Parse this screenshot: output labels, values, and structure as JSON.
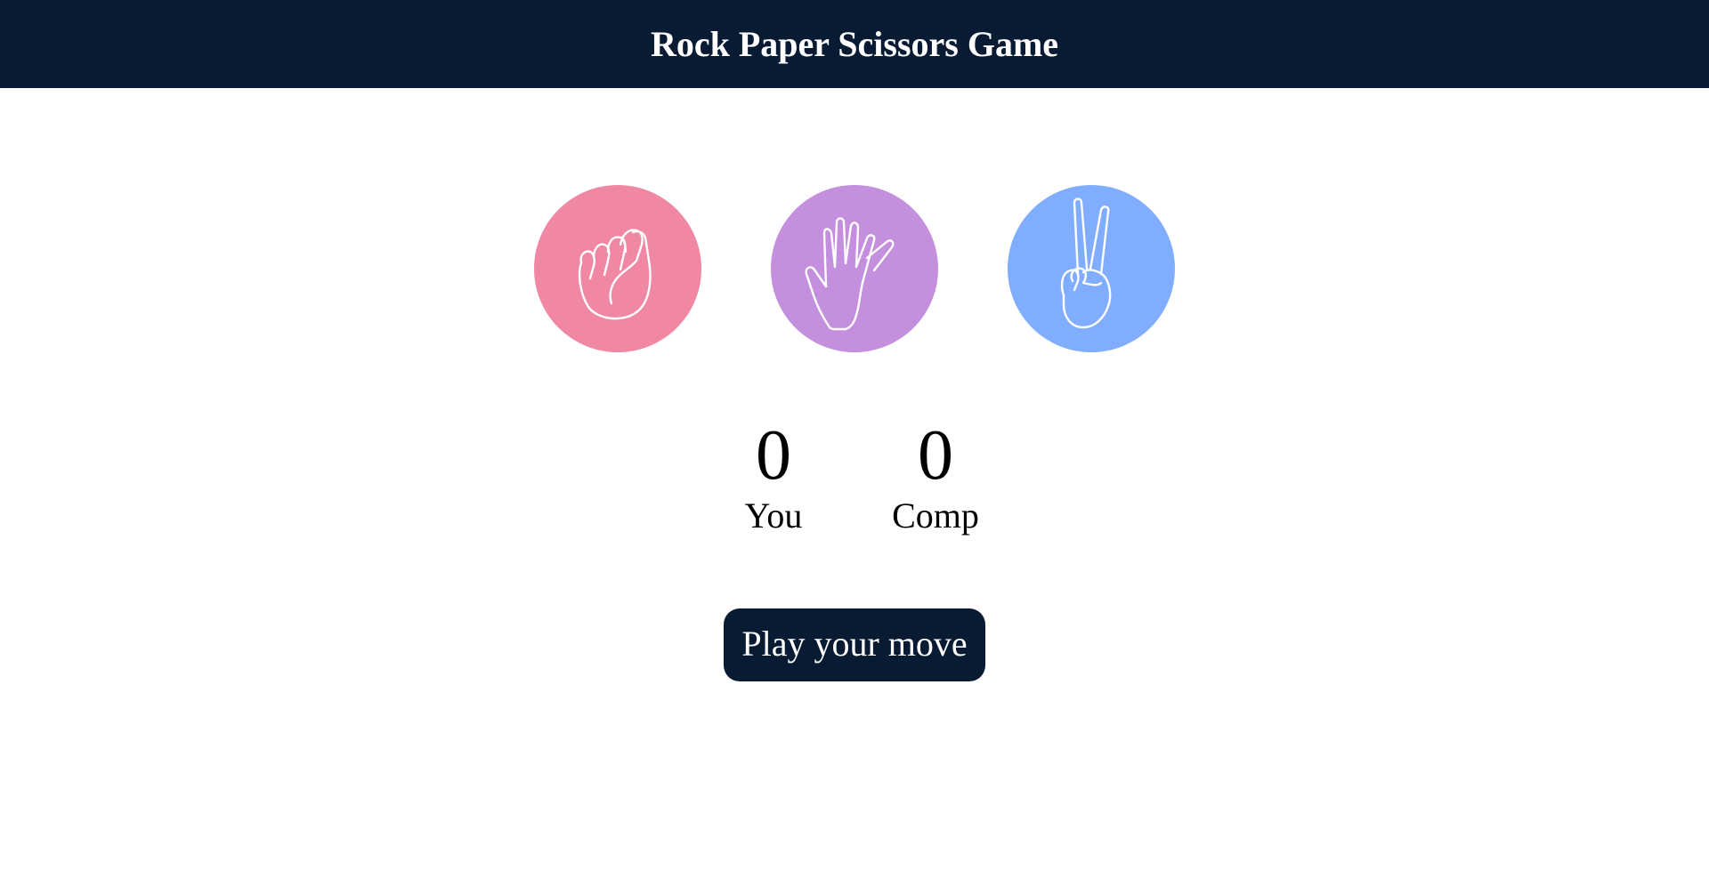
{
  "header": {
    "title": "Rock Paper Scissors Game"
  },
  "choices": [
    {
      "name": "rock",
      "icon": "fist-icon",
      "color": "#f087a3"
    },
    {
      "name": "paper",
      "icon": "open-hand-icon",
      "color": "#c490de"
    },
    {
      "name": "scissors",
      "icon": "peace-hand-icon",
      "color": "#80adff"
    }
  ],
  "scores": {
    "user": {
      "value": "0",
      "label": "You"
    },
    "comp": {
      "value": "0",
      "label": "Comp"
    }
  },
  "message": {
    "text": "Play your move",
    "background": "#081b33"
  },
  "colors": {
    "header_bg": "#081b33",
    "text": "#000000"
  }
}
